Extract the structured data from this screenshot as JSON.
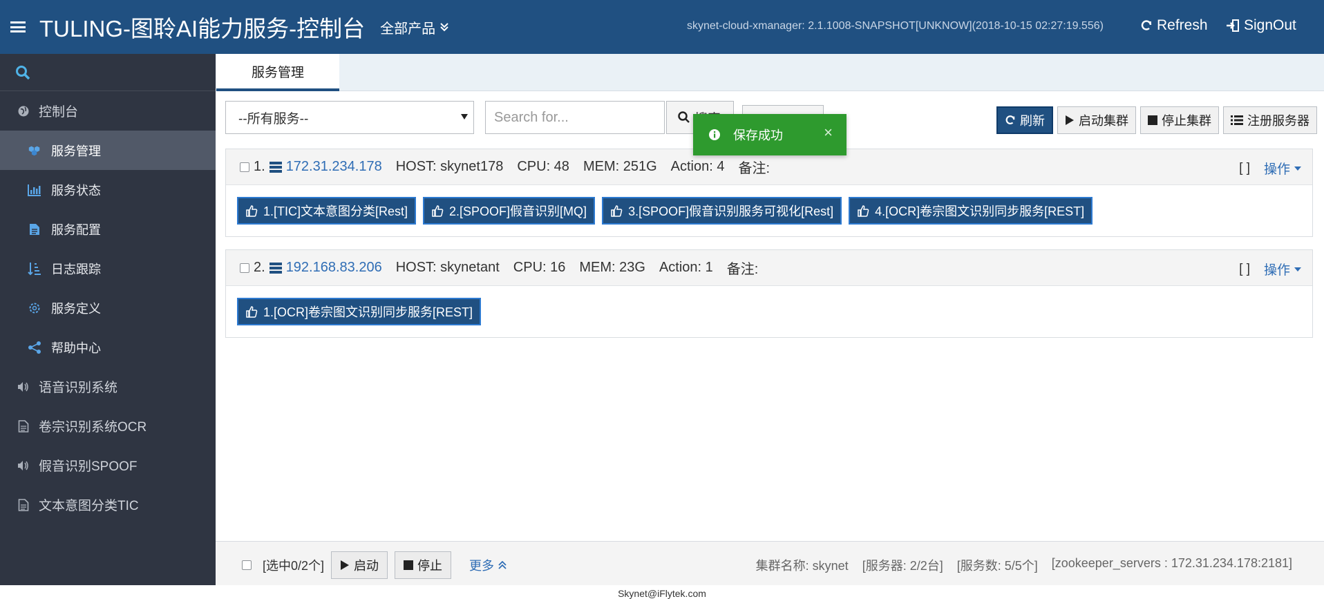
{
  "header": {
    "title": "TULING-图聆AI能力服务-控制台",
    "products_label": "全部产品",
    "version": "skynet-cloud-xmanager: 2.1.1008-SNAPSHOT[UNKNOW](2018-10-15 02:27:19.556)",
    "refresh_label": "Refresh",
    "signout_label": "SignOut"
  },
  "sidebar": {
    "items": [
      {
        "label": "控制台",
        "icon": "globe-icon",
        "level": "top"
      },
      {
        "label": "服务管理",
        "icon": "cluster-icon",
        "level": "sub",
        "active": true
      },
      {
        "label": "服务状态",
        "icon": "bar-chart-icon",
        "level": "sub"
      },
      {
        "label": "服务配置",
        "icon": "file-text-icon",
        "level": "sub"
      },
      {
        "label": "日志跟踪",
        "icon": "sort-list-icon",
        "level": "sub"
      },
      {
        "label": "服务定义",
        "icon": "gear-icon",
        "level": "sub"
      },
      {
        "label": "帮助中心",
        "icon": "share-icon",
        "level": "sub"
      },
      {
        "label": "语音识别系统",
        "icon": "volume-icon",
        "level": "top"
      },
      {
        "label": "卷宗识别系统OCR",
        "icon": "document-icon",
        "level": "top"
      },
      {
        "label": "假音识别SPOOF",
        "icon": "volume-icon",
        "level": "top"
      },
      {
        "label": "文本意图分类TIC",
        "icon": "document-icon",
        "level": "top"
      }
    ]
  },
  "tabs": [
    {
      "label": "服务管理"
    }
  ],
  "toolbar": {
    "select_value": "--所有服务--",
    "search_placeholder": "Search for...",
    "search_button": "搜索",
    "buttons": {
      "refresh": "刷新",
      "start_cluster": "启动集群",
      "stop_cluster": "停止集群",
      "register_server": "注册服务器"
    }
  },
  "toast": {
    "message": "保存成功"
  },
  "hosts": [
    {
      "index": "1.",
      "ip": "172.31.234.178",
      "host": "HOST:  skynet178",
      "cpu": "CPU:  48",
      "mem": "MEM:  251G",
      "action": "Action:  4",
      "note": "备注:",
      "brackets": "[ ]",
      "op_label": "操作",
      "services": [
        "1.[TIC]文本意图分类[Rest]",
        "2.[SPOOF]假音识别[MQ]",
        "3.[SPOOF]假音识别服务可视化[Rest]",
        "4.[OCR]卷宗图文识别同步服务[REST]"
      ]
    },
    {
      "index": "2.",
      "ip": "192.168.83.206",
      "host": "HOST:  skynetant",
      "cpu": "CPU:  16",
      "mem": "MEM:  23G",
      "action": "Action:  1",
      "note": "备注:",
      "brackets": "[ ]",
      "op_label": "操作",
      "services": [
        "1.[OCR]卷宗图文识别同步服务[REST]"
      ]
    }
  ],
  "footer": {
    "selected": "[选中0/2个]",
    "start": "启动",
    "stop": "停止",
    "more": "更多",
    "cluster_name": "集群名称: skynet",
    "servers": "[服务器: 2/2台]",
    "services": "[服务数: 5/5个]",
    "zookeeper": "[zookeeper_servers : 172.31.234.178:2181]"
  },
  "copyright": "Skynet@iFlytek.com",
  "colors": {
    "brand": "#205081",
    "sidebar": "#2f3542",
    "toast": "#2e9a2e",
    "link": "#2f6db5"
  }
}
